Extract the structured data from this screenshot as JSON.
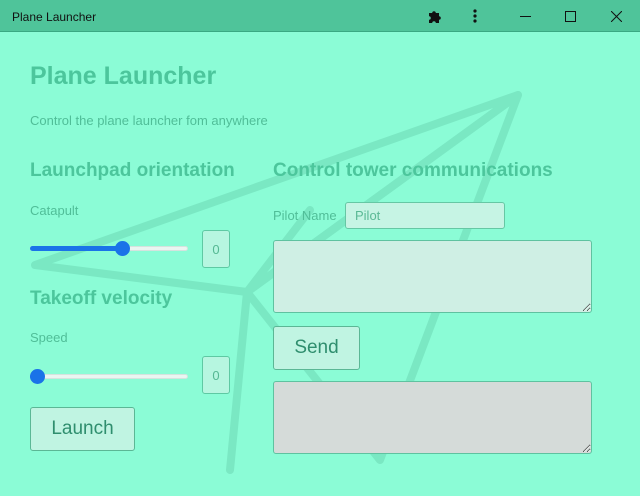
{
  "window": {
    "title": "Plane Launcher",
    "controls": [
      "extensions-icon",
      "more-icon",
      "minimize-icon",
      "maximize-icon",
      "close-icon"
    ]
  },
  "header": {
    "title": "Plane Launcher",
    "subtitle": "Control the plane launcher fom anywhere"
  },
  "orientation": {
    "heading": "Launchpad orientation",
    "slider_label": "Catapult",
    "slider_fraction": 0.6,
    "value": "0"
  },
  "velocity": {
    "heading": "Takeoff velocity",
    "slider_label": "Speed",
    "slider_fraction": 0.0,
    "value": "0",
    "launch_label": "Launch"
  },
  "communications": {
    "heading": "Control tower communications",
    "pilot_label": "Pilot Name",
    "pilot_placeholder": "Pilot",
    "message_value": "",
    "send_label": "Send",
    "log_value": ""
  },
  "colors": {
    "background": "#8bfcd6",
    "titlebar": "#4fc49a",
    "heading": "#4cc69c",
    "slider_accent": "#1a73e8"
  }
}
